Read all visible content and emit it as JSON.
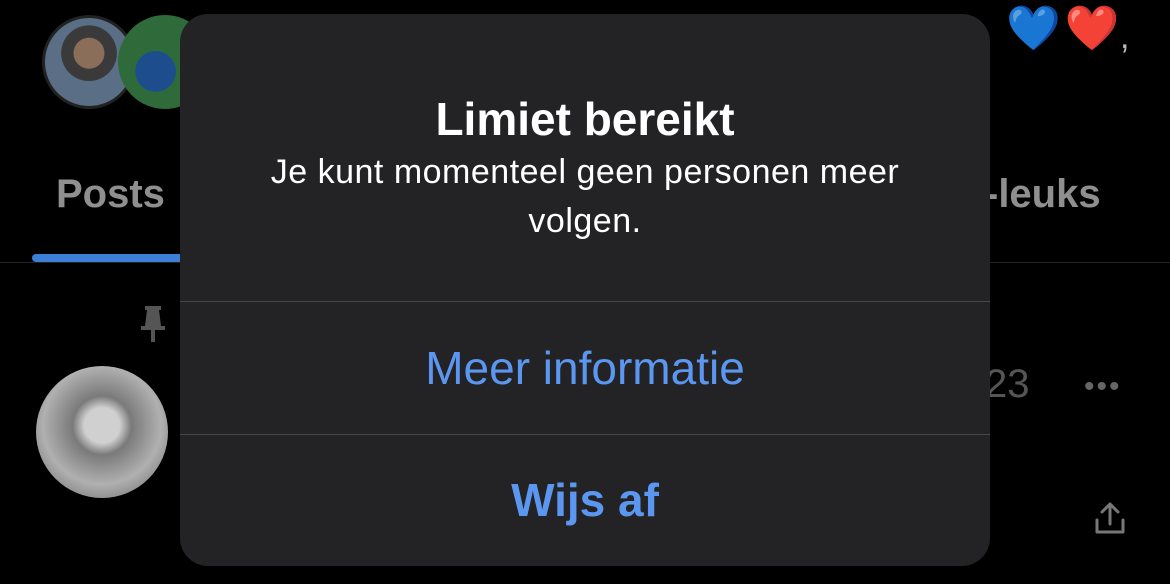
{
  "background": {
    "header_text": "",
    "hearts": "💙❤️",
    "tabs": [
      {
        "label": "Posts"
      },
      {
        "label": "-leuks"
      }
    ],
    "post": {
      "date_fragment": "23",
      "more": "•••"
    }
  },
  "dialog": {
    "title": "Limiet bereikt",
    "message": "Je kunt momenteel geen personen meer volgen.",
    "buttons": {
      "more_info": "Meer informatie",
      "dismiss": "Wijs af"
    }
  },
  "colors": {
    "accent": "#5b97f0",
    "dialog_bg": "#232325",
    "tab_indicator": "#3d7fd6"
  }
}
